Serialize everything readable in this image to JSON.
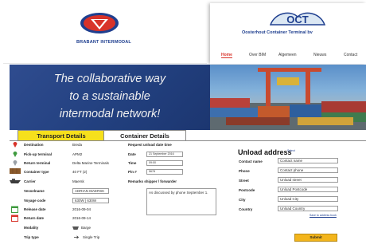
{
  "header": {
    "brand_left": "BRABANT INTERMODAL",
    "brand_right_logo": "OCT",
    "brand_right_sub": "Oosterhout Container Terminal bv",
    "nav": [
      "Home",
      "Over BIM",
      "Algemeen",
      "Nieuws",
      "Contact"
    ],
    "nav_active": "Home"
  },
  "banner": {
    "line1": "The collaborative way",
    "line2": "to a sustainable",
    "line3": "intermodal network!"
  },
  "tabs": {
    "transport": "Transport Details",
    "container": "Container Details"
  },
  "left_form": [
    {
      "label": "Destination",
      "value": "Breda",
      "icon": "location-pin-red-icon"
    },
    {
      "label": "Pick-up terminal",
      "value": "APM2",
      "icon": "location-pin-green-icon"
    },
    {
      "label": "Return terminal",
      "value": "Delta Marine Terminals",
      "icon": "location-pin-grey-icon"
    },
    {
      "label": "Container type",
      "value": "40 FT (2)",
      "icon": "container-icon"
    },
    {
      "label": "Carrier",
      "value": "Maersk",
      "icon": "ship-icon"
    },
    {
      "label": "Vesselname",
      "value": "ADRIAN MAERSK",
      "icon": ""
    },
    {
      "label": "Voyage code",
      "value": "630W | 630W",
      "icon": ""
    },
    {
      "label": "Release date",
      "value": "2016-09-04",
      "icon": "calendar-green-icon"
    },
    {
      "label": "Return date",
      "value": "2016-09-14",
      "icon": "calendar-red-icon"
    },
    {
      "label": "Modality",
      "value": "Barge",
      "icon": ""
    },
    {
      "label": "Trip type",
      "value": "Single Trip",
      "icon": ""
    }
  ],
  "middle_form": {
    "section_title": "Request unload date time",
    "date_label": "Date",
    "date_value": "21 September 2016",
    "time_label": "Time",
    "time_value": "09:00",
    "pin_label": "Pin #",
    "pin_value": "5678",
    "remarks_label": "Remarks shipper / forwarder",
    "remarks_value": "As discussed by phone September 1."
  },
  "unload": {
    "title": "Unload address",
    "subtitle": "Select",
    "fields": [
      {
        "label": "Contact name",
        "placeholder": "Contact name"
      },
      {
        "label": "Phone",
        "placeholder": "Contact phone"
      },
      {
        "label": "Street",
        "placeholder": "Unload street"
      },
      {
        "label": "Postcode",
        "placeholder": "Unload Postcode"
      },
      {
        "label": "City",
        "placeholder": "Unload City"
      },
      {
        "label": "Country",
        "placeholder": "Unload Country"
      }
    ],
    "link": "Save to address book",
    "submit": "Submit"
  },
  "colors": {
    "brand_blue": "#1f3f8f",
    "brand_red": "#d8332a",
    "tab_yellow": "#f6e01c",
    "submit_orange": "#f3b51c"
  }
}
